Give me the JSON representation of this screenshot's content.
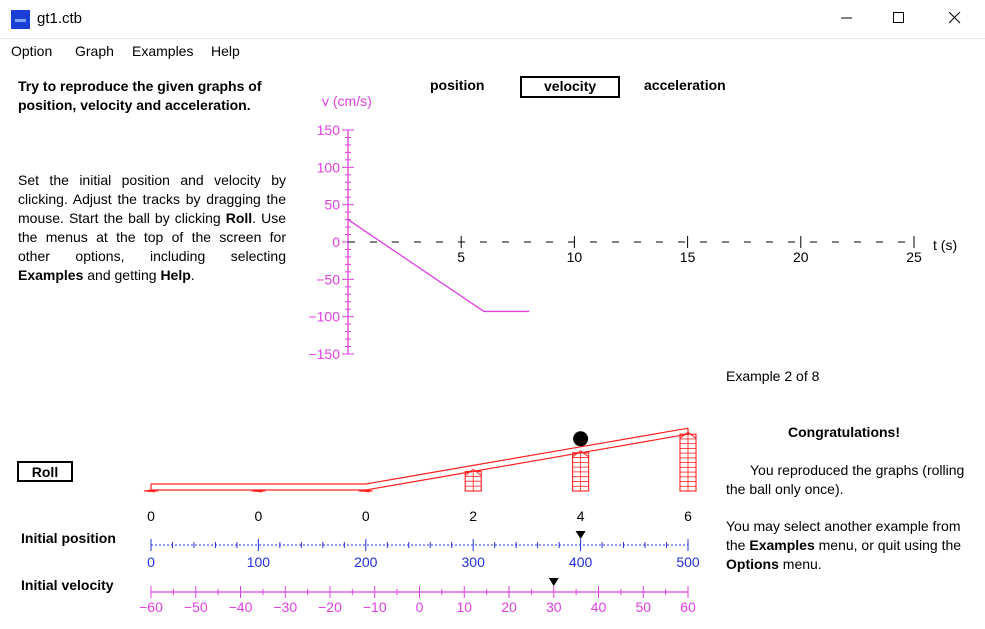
{
  "window": {
    "title": "gt1.ctb"
  },
  "menu": [
    "Option",
    "Graph",
    "Examples",
    "Help"
  ],
  "intro": {
    "heading": "Try to reproduce the given graphs of position, velocity and acceleration.",
    "p1": "Set the initial position and velocity by clicking.  Adjust the tracks by dragging the mouse.  Start the ball by clicking ",
    "roll_word": "Roll",
    "p2": ". Use the menus at the top of the screen for other options, including selecting ",
    "examples_word": "Examples",
    "p3": " and getting ",
    "help_word": "Help",
    "p4": "."
  },
  "graph_tabs": {
    "position": "position",
    "velocity": "velocity",
    "acceleration": "acceleration",
    "selected": "velocity"
  },
  "chart_data": {
    "type": "line",
    "ylabel": "v (cm/s)",
    "xlabel": "t (s)",
    "xlim": [
      0,
      25
    ],
    "ylim": [
      -150,
      150
    ],
    "x_ticks": [
      "5",
      "10",
      "15",
      "20",
      "25"
    ],
    "y_ticks": [
      "150",
      "100",
      "50",
      "0",
      "−50",
      "−100",
      "−150"
    ],
    "series": [
      {
        "x": [
          0,
          6.0,
          8.0
        ],
        "y": [
          30,
          -93,
          -93
        ]
      }
    ],
    "colors": {
      "axis": "#e040e0",
      "line": "#e040e0",
      "zero_line": "#000000"
    }
  },
  "example_label": "Example 2 of 8",
  "congrats": {
    "title": "Congratulations!",
    "line1": "You reproduced the graphs (rolling the ball only once).",
    "line2a": "You may select another example from the ",
    "examples_word": "Examples",
    "line2b": " menu, or quit using the ",
    "options_word": "Options",
    "line2c": " menu."
  },
  "roll_button": "Roll",
  "track": {
    "heights": [
      "0",
      "0",
      "0",
      "2",
      "4",
      "6"
    ],
    "heights_values": [
      0,
      0,
      0,
      2,
      4,
      6
    ],
    "ball_position": 400,
    "color": "#ff2020"
  },
  "initial_position": {
    "label": "Initial position",
    "ticks": [
      "0",
      "100",
      "200",
      "300",
      "400",
      "500"
    ],
    "range": [
      0,
      500
    ],
    "value": 400,
    "color": "#2030e0"
  },
  "initial_velocity": {
    "label": "Initial velocity",
    "ticks": [
      "−60",
      "−50",
      "−40",
      "−30",
      "−20",
      "−10",
      "0",
      "10",
      "20",
      "30",
      "40",
      "50",
      "60"
    ],
    "range": [
      -60,
      60
    ],
    "value": 30,
    "color": "#e040e0"
  }
}
